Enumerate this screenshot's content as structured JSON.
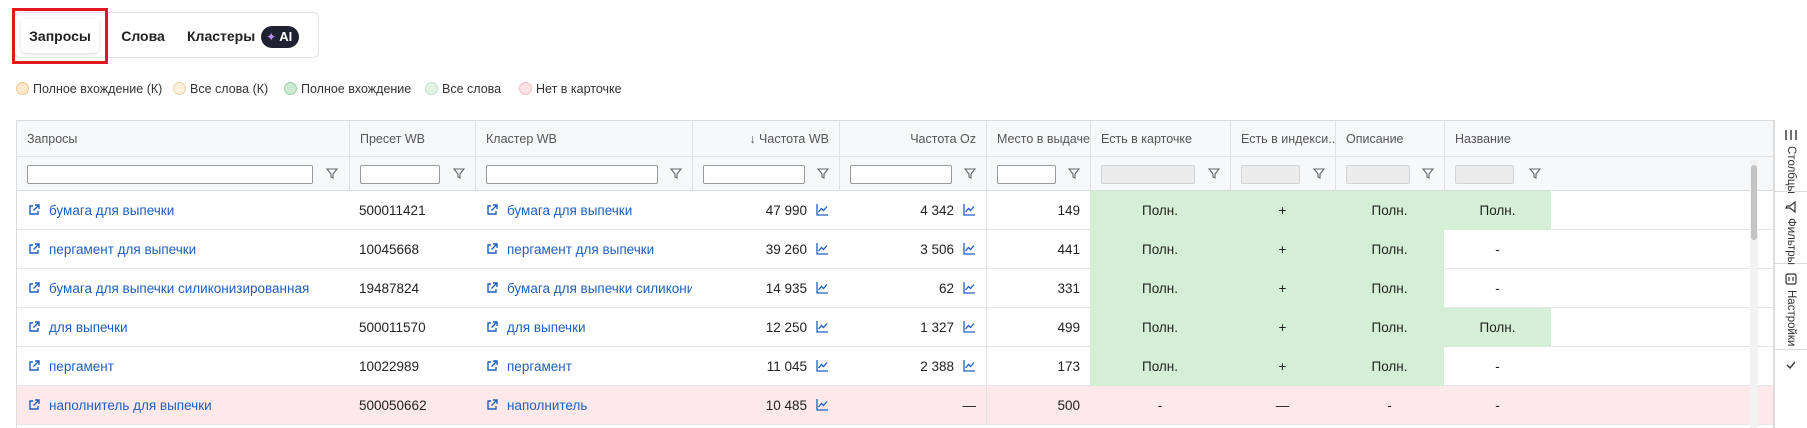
{
  "tabs": {
    "queries": "Запросы",
    "words": "Слова",
    "clusters": "Кластеры",
    "ai_badge": "AI"
  },
  "legend": [
    {
      "label": "Полное вхождение (К)",
      "fill": "#fde9cc",
      "border": "#f0c98a"
    },
    {
      "label": "Все слова (К)",
      "fill": "#fdf0dc",
      "border": "#eed3a6"
    },
    {
      "label": "Полное вхождение",
      "fill": "#cdebd0",
      "border": "#9fd1a4"
    },
    {
      "label": "Все слова",
      "fill": "#e3f4e6",
      "border": "#bfe0c4"
    },
    {
      "label": "Нет в карточке",
      "fill": "#fde3e6",
      "border": "#f2bcc3"
    }
  ],
  "columns": [
    {
      "label": "Запросы"
    },
    {
      "label": "Пресет WB"
    },
    {
      "label": "Кластер WB"
    },
    {
      "label": "↓ Частота WB"
    },
    {
      "label": "Частота Oz"
    },
    {
      "label": "Место в выдаче"
    },
    {
      "label": "Есть в карточке"
    },
    {
      "label": "Есть в индекси..."
    },
    {
      "label": "Описание"
    },
    {
      "label": "Название"
    }
  ],
  "rows": [
    {
      "query": "бумага для выпечки",
      "preset": "500011421",
      "cluster": "бумага для выпечки",
      "freq_wb": "47 990",
      "freq_oz": "4 342",
      "place": "149",
      "in_card": "Полн.",
      "in_index": "+",
      "description": "Полн.",
      "name": "Полн.",
      "red": false,
      "green": [
        true,
        true,
        true,
        true
      ]
    },
    {
      "query": "пергамент для выпечки",
      "preset": "10045668",
      "cluster": "пергамент для выпечки",
      "freq_wb": "39 260",
      "freq_oz": "3 506",
      "place": "441",
      "in_card": "Полн.",
      "in_index": "+",
      "description": "Полн.",
      "name": "-",
      "red": false,
      "green": [
        true,
        true,
        true,
        false
      ]
    },
    {
      "query": "бумага для выпечки силиконизированная",
      "preset": "19487824",
      "cluster": "бумага для выпечки силиконизированная",
      "freq_wb": "14 935",
      "freq_oz": "62",
      "place": "331",
      "in_card": "Полн.",
      "in_index": "+",
      "description": "Полн.",
      "name": "-",
      "red": false,
      "green": [
        true,
        true,
        true,
        false
      ]
    },
    {
      "query": "для выпечки",
      "preset": "500011570",
      "cluster": "для выпечки",
      "freq_wb": "12 250",
      "freq_oz": "1 327",
      "place": "499",
      "in_card": "Полн.",
      "in_index": "+",
      "description": "Полн.",
      "name": "Полн.",
      "red": false,
      "green": [
        true,
        true,
        true,
        true
      ]
    },
    {
      "query": "пергамент",
      "preset": "10022989",
      "cluster": "пергамент",
      "freq_wb": "11 045",
      "freq_oz": "2 388",
      "place": "173",
      "in_card": "Полн.",
      "in_index": "+",
      "description": "Полн.",
      "name": "-",
      "red": false,
      "green": [
        true,
        true,
        true,
        false
      ]
    },
    {
      "query": "наполнитель для выпечки",
      "preset": "500050662",
      "cluster": "наполнитель",
      "freq_wb": "10 485",
      "freq_oz": "—",
      "place": "500",
      "in_card": "-",
      "in_index": "—",
      "description": "-",
      "name": "-",
      "red": true,
      "green": [
        false,
        false,
        false,
        false
      ]
    }
  ],
  "side_panel": {
    "columns": "Столбцы",
    "filters": "Фильтры",
    "settings": "Настройки"
  },
  "colors": {
    "link": "#1e5fbf",
    "green_cell": "#d4efd5",
    "red_row": "#fde8ea",
    "highlight_frame": "#e0191f"
  }
}
